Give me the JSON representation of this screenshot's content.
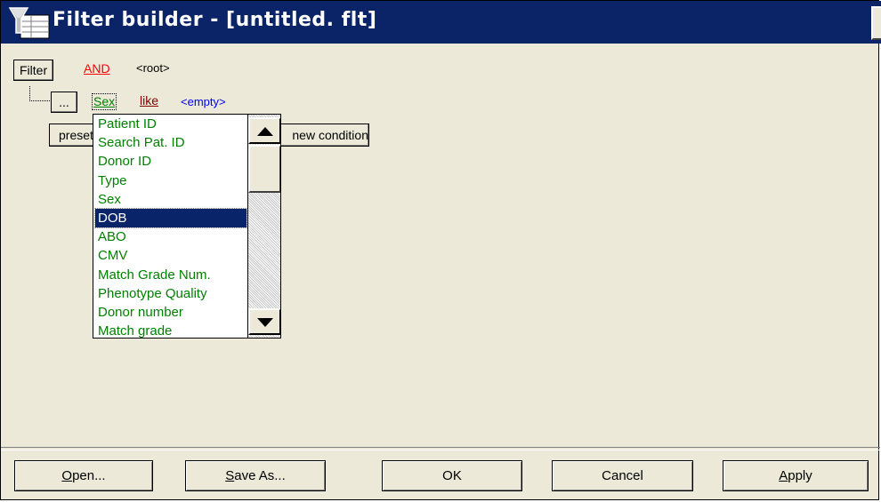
{
  "window": {
    "title": "Filter builder - [untitled. flt]",
    "close_label": "✕"
  },
  "filter": {
    "filter_button": "Filter",
    "operator": "AND",
    "root_label": "<root>",
    "condition": {
      "options_button": "...",
      "field": "Sex",
      "operator": "like",
      "value": "<empty>"
    },
    "preset_button": "preset",
    "new_condition_button": "new condition"
  },
  "dropdown": {
    "items": [
      "Patient ID",
      "Search Pat. ID",
      "Donor ID",
      "Type",
      "Sex",
      "DOB",
      "ABO",
      "CMV",
      "Match Grade Num.",
      "Phenotype Quality",
      "Donor number",
      "Match grade"
    ],
    "selected": "DOB",
    "scroll_up_icon": "arrow-up-icon",
    "scroll_down_icon": "arrow-down-icon"
  },
  "buttons": {
    "open": {
      "mnemonic": "O",
      "rest": "pen..."
    },
    "save_as": {
      "mnemonic": "S",
      "rest": "ave As..."
    },
    "ok": "OK",
    "cancel": "Cancel",
    "apply": {
      "mnemonic": "A",
      "rest": "pply"
    }
  },
  "colors": {
    "titlebar": "#0b2468",
    "field_green": "#008000",
    "and_red": "#ff0000",
    "operator_maroon": "#800000",
    "value_blue": "#0000ff",
    "selection": "#0a246a"
  }
}
